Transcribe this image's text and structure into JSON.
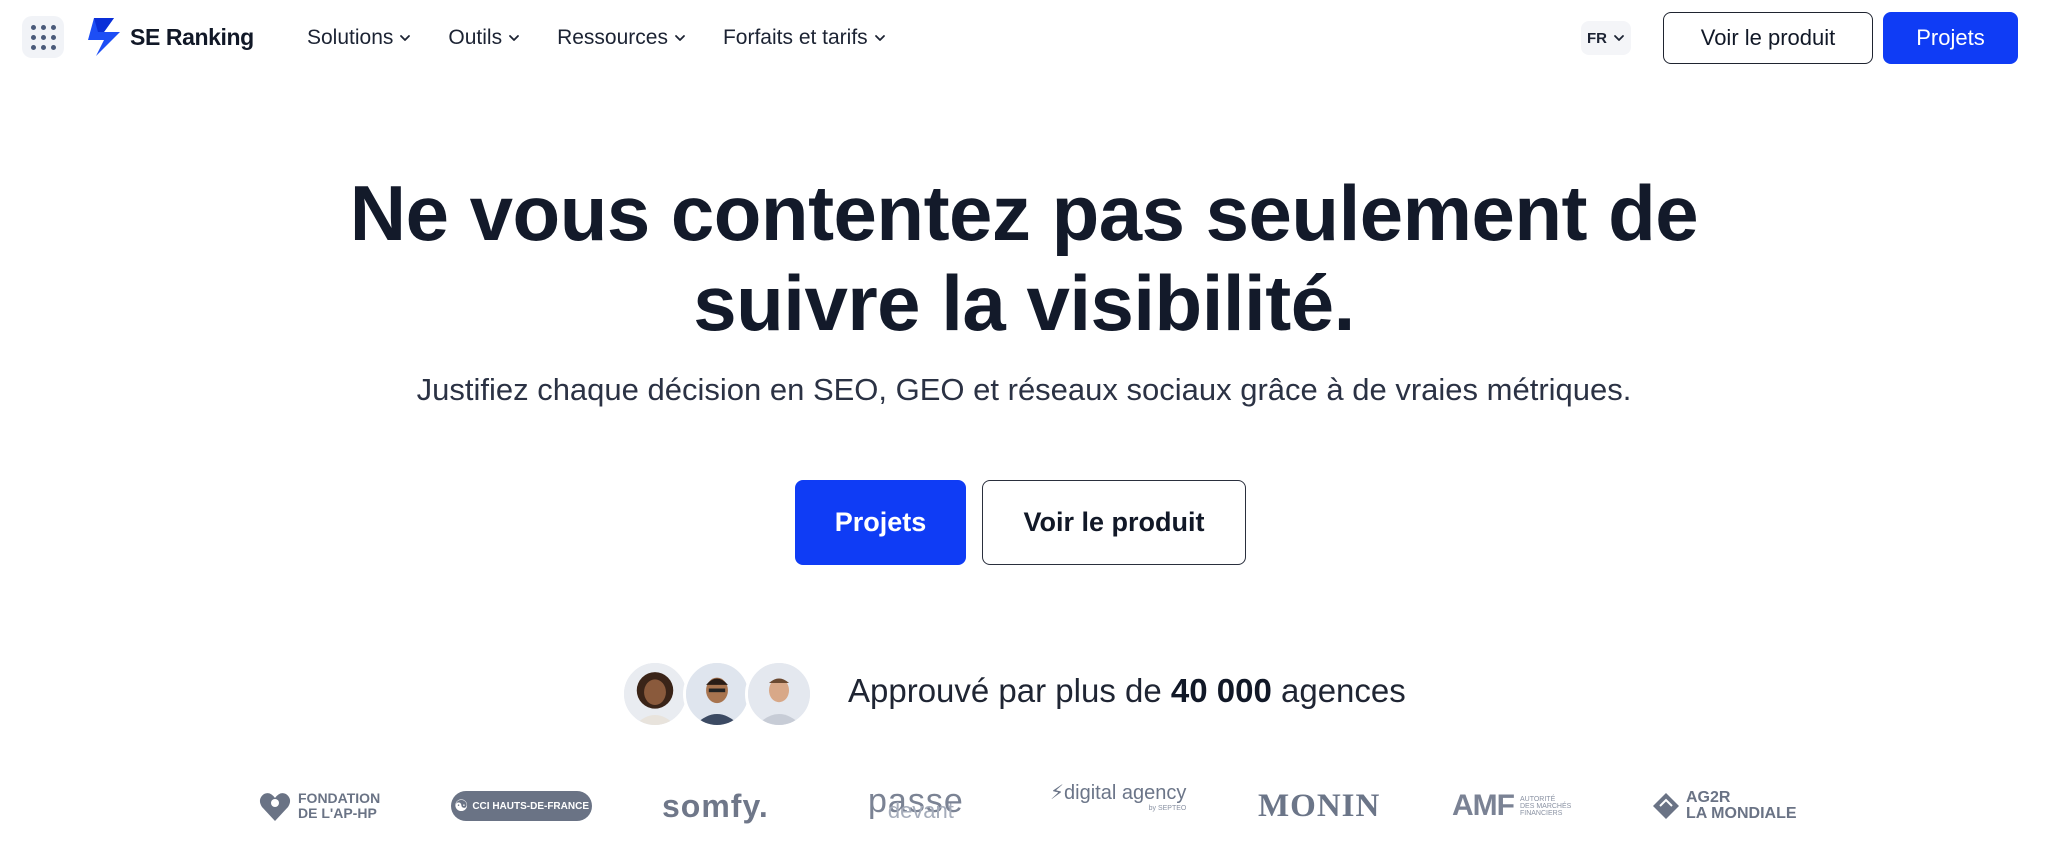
{
  "header": {
    "logo_text": "SE Ranking",
    "nav": [
      {
        "label": "Solutions"
      },
      {
        "label": "Outils"
      },
      {
        "label": "Ressources"
      },
      {
        "label": "Forfaits et tarifs"
      }
    ],
    "language": "FR",
    "view_product_label": "Voir le produit",
    "projects_label": "Projets"
  },
  "hero": {
    "title_line1": "Ne vous contentez pas seulement de",
    "title_line2": "suivre la visibilité.",
    "subtitle": "Justifiez chaque décision en SEO, GEO et réseaux sociaux grâce à de vraies métriques.",
    "primary_cta": "Projets",
    "secondary_cta": "Voir le produit"
  },
  "social_proof": {
    "prefix": "Approuvé par plus de ",
    "count": "40 000",
    "suffix": " agences"
  },
  "logos": {
    "fondation_line1": "FONDATION",
    "fondation_line2": "DE L'AP-HP",
    "cci": "CCI HAUTS-DE-FRANCE",
    "somfy": "somfy.",
    "passe_line1": "passe",
    "passe_line2": "devant",
    "digital_agency": "digital agency",
    "digital_agency_sub": "by SEPTEO",
    "monin": "MONIN",
    "amf": "AMF",
    "amf_sub_line1": "AUTORITÉ",
    "amf_sub_line2": "DES MARCHÉS",
    "amf_sub_line3": "FINANCIERS",
    "ag2r_line1": "AG2R",
    "ag2r_line2": "LA MONDIALE"
  },
  "colors": {
    "primary": "#0f3cf5",
    "text": "#131a2a",
    "logo_gray": "#6b7588"
  },
  "icons": {
    "apps": "grid-dots-icon",
    "chevron": "chevron-down-icon",
    "logo": "se-ranking-bolt-icon"
  }
}
